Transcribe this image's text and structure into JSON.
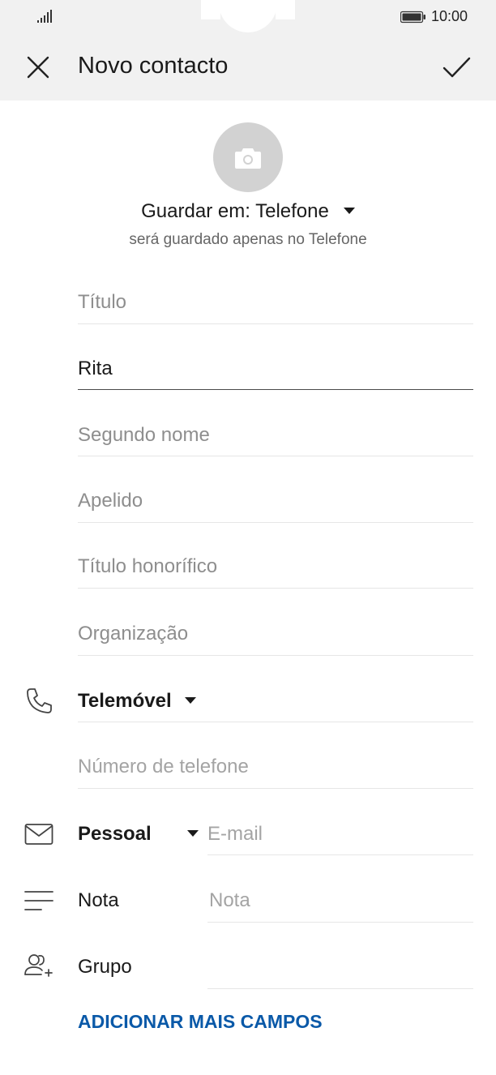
{
  "status_bar": {
    "time": "10:00"
  },
  "header": {
    "title": "Novo contacto"
  },
  "storage": {
    "label": "Guardar em: Telefone",
    "subtitle": "será guardado apenas no Telefone"
  },
  "fields": {
    "title_placeholder": "Título",
    "first_name_value": "Rita",
    "middle_name_placeholder": "Segundo nome",
    "last_name_placeholder": "Apelido",
    "honorific_placeholder": "Título honorífico",
    "organization_placeholder": "Organização"
  },
  "phone": {
    "type_label": "Telemóvel",
    "number_placeholder": "Número de telefone"
  },
  "email": {
    "type_label": "Pessoal",
    "placeholder": "E-mail"
  },
  "note": {
    "label": "Nota",
    "placeholder": "Nota"
  },
  "group": {
    "label": "Grupo"
  },
  "actions": {
    "add_more_fields": "ADICIONAR MAIS CAMPOS"
  },
  "colors": {
    "accent": "#0a59a8",
    "header_bg": "#f1f1f1",
    "avatar_bg": "#d2d2d2"
  }
}
